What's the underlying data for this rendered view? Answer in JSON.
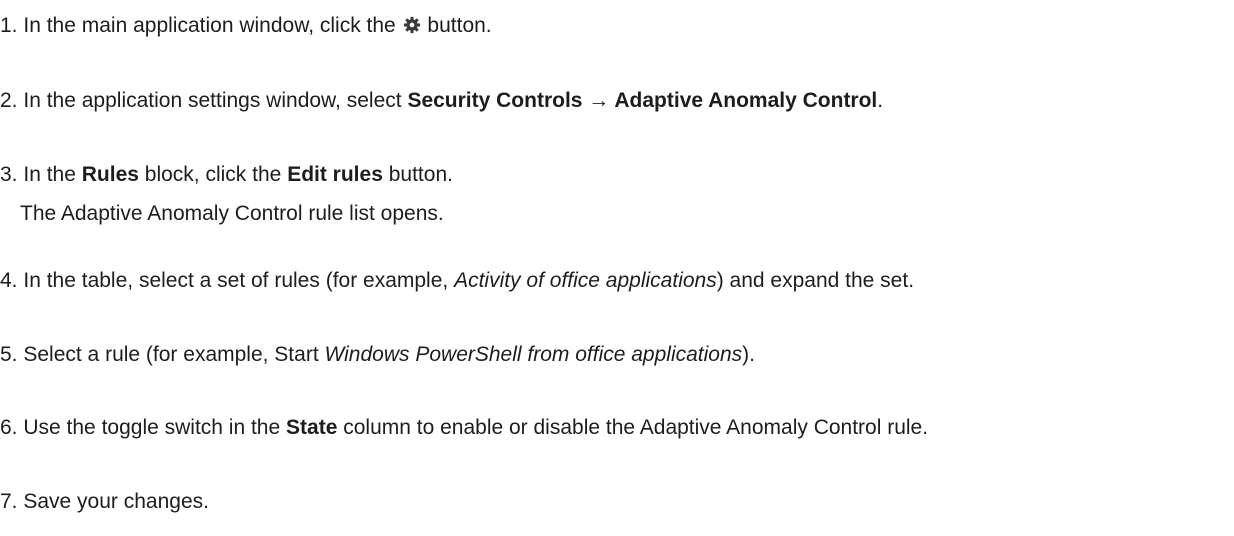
{
  "steps": [
    {
      "number": "1.",
      "parts": [
        "In the main application window, click the",
        "button."
      ],
      "icon": "gear-icon"
    },
    {
      "number": "2.",
      "parts": [
        "In the application settings window, select",
        "Security Controls → Adaptive Anomaly Control",
        "."
      ]
    },
    {
      "number": "3.",
      "parts": [
        "In the",
        "Rules",
        "block, click the",
        "Edit rules",
        "button."
      ],
      "note": "The Adaptive Anomaly Control rule list opens."
    },
    {
      "number": "4.",
      "parts": [
        "In the table, select a set of rules (for example,",
        "Activity of office applications",
        ") and expand the set."
      ]
    },
    {
      "number": "5.",
      "parts": [
        "Select a rule (for example, Start",
        "Windows PowerShell from office applications",
        ")."
      ]
    },
    {
      "number": "6.",
      "parts": [
        "Use the toggle switch in the",
        "State",
        "column to enable or disable the Adaptive Anomaly Control rule."
      ]
    },
    {
      "number": "7.",
      "parts": [
        "Save your changes."
      ]
    }
  ]
}
